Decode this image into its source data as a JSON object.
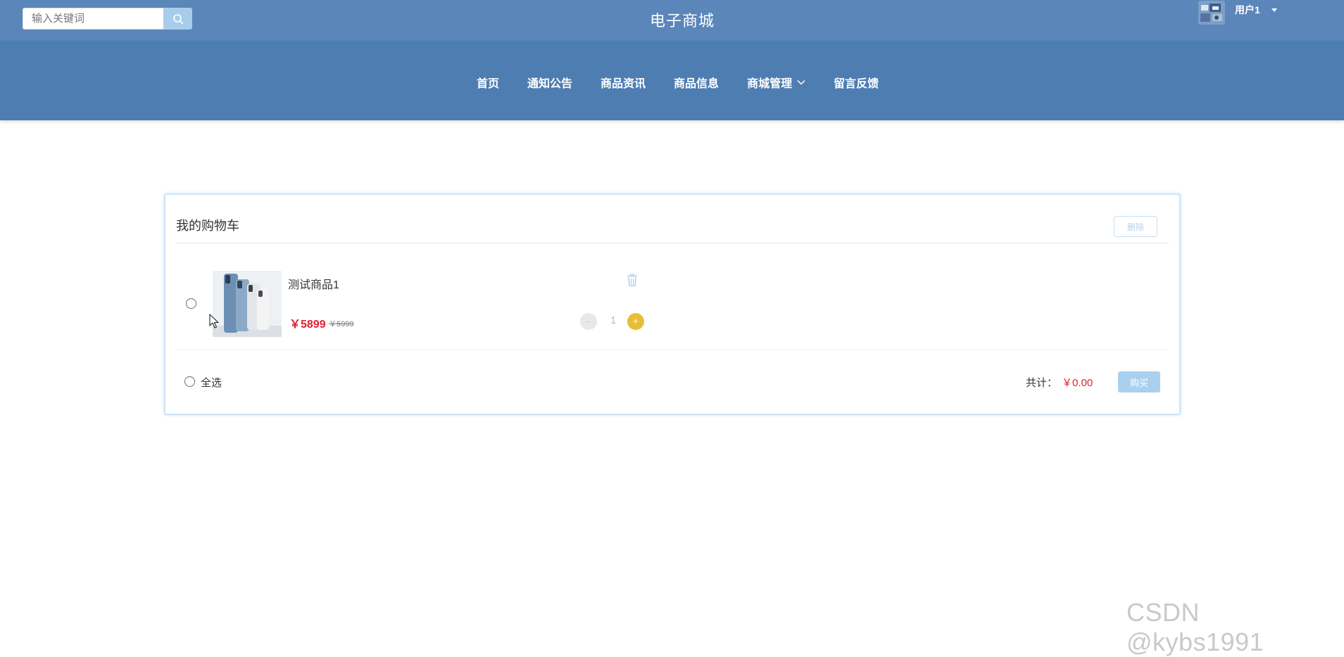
{
  "header": {
    "search_placeholder": "输入关键词",
    "site_title": "电子商城",
    "user_name": "用户1",
    "icons": {
      "search": "search-icon",
      "user_menu": "caret-down-icon",
      "avatar": "avatar-image"
    }
  },
  "nav": {
    "items": [
      {
        "label": "首页"
      },
      {
        "label": "通知公告"
      },
      {
        "label": "商品资讯"
      },
      {
        "label": "商品信息"
      },
      {
        "label": "商城管理",
        "has_dropdown": true
      },
      {
        "label": "留言反馈"
      }
    ]
  },
  "cart": {
    "title": "我的购物车",
    "delete_label": "删除",
    "items": [
      {
        "name": "测试商品1",
        "price": "￥5899",
        "original_price": "￥5999",
        "quantity": "1",
        "minus_label": "-",
        "plus_label": "+",
        "selected": false
      }
    ],
    "select_all_label": "全选",
    "total_label": "共计：",
    "total_value": "￥0.00",
    "buy_label": "购买"
  },
  "watermark": "CSDN @kybs1991",
  "colors": {
    "topbar": "#5a86ba",
    "navbar": "#4e7db2",
    "accent_light": "#a9d0ee",
    "price_red": "#e0202f",
    "plus_button": "#e7be3a"
  }
}
